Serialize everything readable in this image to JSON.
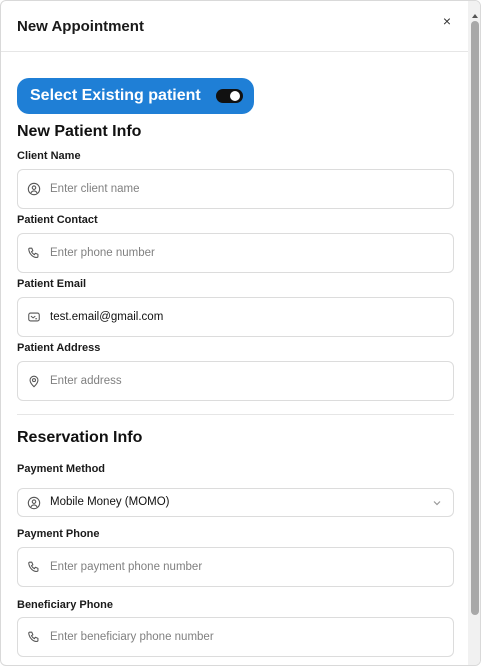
{
  "dialog": {
    "title": "New Appointment",
    "close_glyph": "×"
  },
  "toggle": {
    "label": "Select Existing patient",
    "state": "on"
  },
  "patient_section": {
    "heading": "New Patient Info",
    "client_name": {
      "label": "Client Name",
      "placeholder": "Enter client name",
      "value": "",
      "icon": "user-icon"
    },
    "contact": {
      "label": "Patient Contact",
      "placeholder": "Enter phone number",
      "value": "",
      "icon": "phone-icon"
    },
    "email": {
      "label": "Patient Email",
      "placeholder": "",
      "value": "test.email@gmail.com",
      "icon": "mail-icon"
    },
    "address": {
      "label": "Patient Address",
      "placeholder": "Enter address",
      "value": "",
      "icon": "location-pin-icon"
    }
  },
  "reservation_section": {
    "heading": "Reservation Info",
    "payment_method": {
      "label": "Payment Method",
      "selected": "Mobile Money (MOMO)",
      "icon": "user-icon"
    },
    "payment_phone": {
      "label": "Payment Phone",
      "placeholder": "Enter payment phone number",
      "value": "",
      "icon": "phone-icon"
    },
    "beneficiary_phone": {
      "label": "Beneficiary Phone",
      "placeholder": "Enter beneficiary phone number",
      "value": "",
      "icon": "phone-icon"
    }
  },
  "colors": {
    "accent": "#1f7fd6",
    "border": "#dcdcdc",
    "placeholder": "#808080"
  }
}
